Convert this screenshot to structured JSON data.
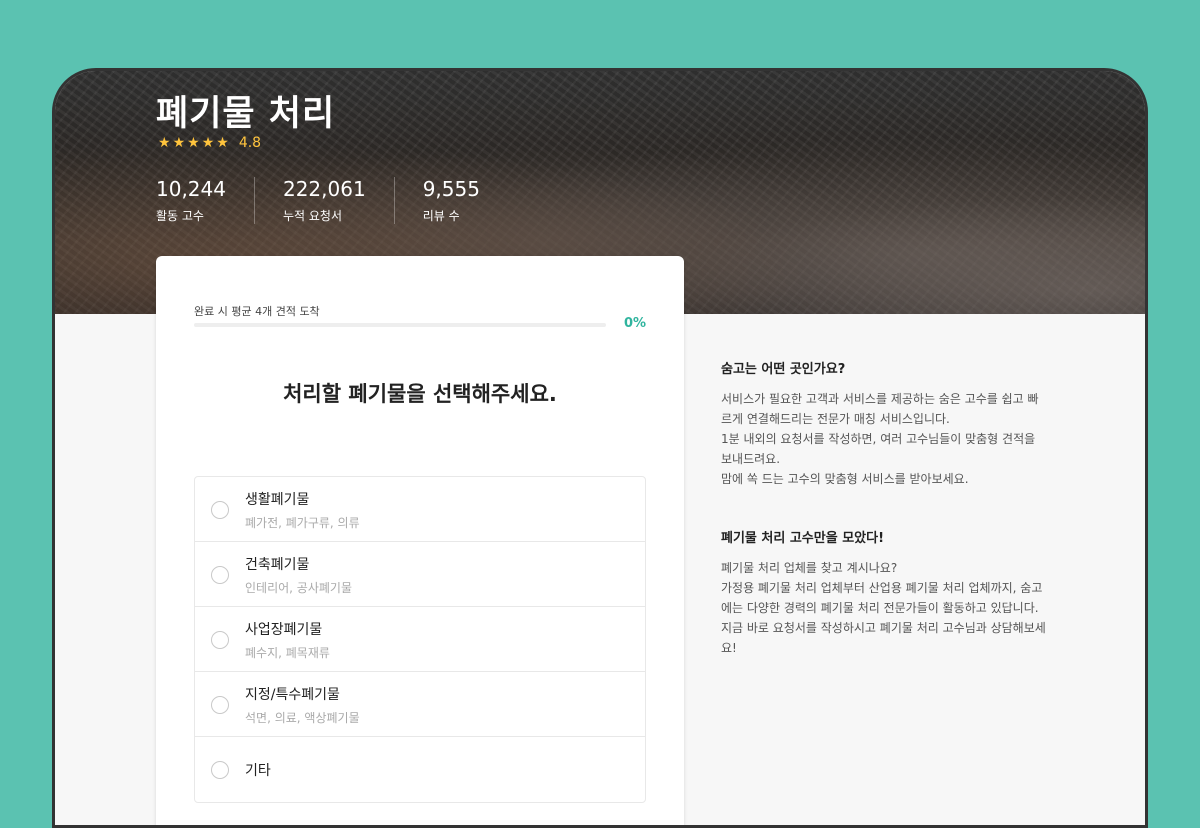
{
  "hero": {
    "title": "폐기물 처리",
    "rating": "4.8",
    "stars": 5,
    "stats": [
      {
        "value": "10,244",
        "label": "활동 고수"
      },
      {
        "value": "222,061",
        "label": "누적 요청서"
      },
      {
        "value": "9,555",
        "label": "리뷰 수"
      }
    ]
  },
  "form": {
    "progress_label": "완료 시 평균 4개 견적 도착",
    "progress_value": 0,
    "progress_text": "0%",
    "question": "처리할 폐기물을 선택해주세요.",
    "options": [
      {
        "title": "생활폐기물",
        "subtitle": "폐가전, 폐가구류, 의류"
      },
      {
        "title": "건축폐기물",
        "subtitle": "인테리어, 공사폐기물"
      },
      {
        "title": "사업장폐기물",
        "subtitle": "폐수지, 폐목재류"
      },
      {
        "title": "지정/특수폐기물",
        "subtitle": "석면, 의료, 액상폐기물"
      },
      {
        "title": "기타",
        "subtitle": ""
      }
    ]
  },
  "info": {
    "block1_title": "숨고는 어떤 곳인가요?",
    "block1_body": "서비스가 필요한 고객과 서비스를 제공하는 숨은 고수를 쉽고 빠\n르게 연결해드리는 전문가 매칭 서비스입니다.\n1분 내외의 요청서를 작성하면, 여러 고수님들이 맞춤형 견적을\n보내드려요.\n맘에 쏙 드는 고수의 맞춤형 서비스를 받아보세요.",
    "block2_title": "폐기물 처리 고수만을 모았다!",
    "block2_body": "폐기물 처리 업체를 찾고 계시나요?\n가정용 폐기물 처리 업체부터 산업용 폐기물 처리 업체까지, 숨고\n에는 다양한 경력의 폐기물 처리 전문가들이 활동하고 있답니다.\n지금 바로 요청서를 작성하시고 폐기물 처리 고수님과 상담해보세\n요!"
  },
  "colors": {
    "background": "#5bc2b1",
    "accent": "#00c7ae",
    "star": "#ffc43d"
  }
}
